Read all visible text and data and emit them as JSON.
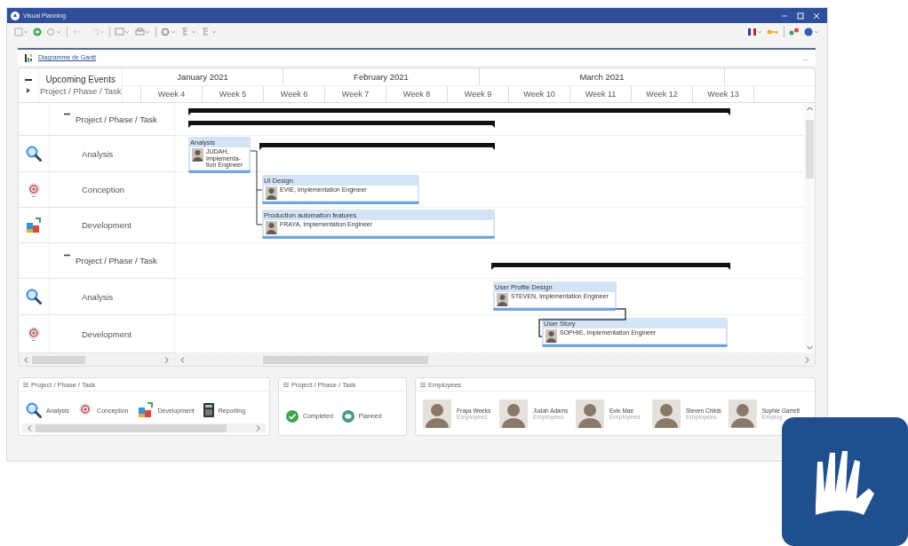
{
  "window": {
    "title": "Visual Planning"
  },
  "tab": {
    "label": "Diagramme de Gantt",
    "menu": "..."
  },
  "gantt": {
    "header_title": "Upcoming Events",
    "header_subtitle": "Project / Phase / Task",
    "months": [
      "January 2021",
      "February 2021",
      "March 2021"
    ],
    "weeks": [
      "Week 4",
      "Week 5",
      "Week 6",
      "Week 7",
      "Week 8",
      "Week 9",
      "Week 10",
      "Week 11",
      "Week 12",
      "Week 13"
    ],
    "rows": [
      {
        "kind": "group",
        "label": "Project / Phase / Task",
        "expanded": true,
        "tasks": []
      },
      {
        "kind": "analysis",
        "label": "Analysis",
        "tasks": [
          {
            "title": "Analysis",
            "assignee": "JUDAH, Implementa-tion Engineer"
          }
        ]
      },
      {
        "kind": "conception",
        "label": "Conception",
        "tasks": [
          {
            "title": "UI Design",
            "assignee": "EVIE, Implementation Engineer"
          }
        ]
      },
      {
        "kind": "development",
        "label": "Development",
        "tasks": [
          {
            "title": "Production automation features",
            "assignee": "FRAYA, Implementation Engineer"
          }
        ]
      },
      {
        "kind": "group",
        "label": "Project / Phase / Task",
        "expanded": true,
        "tasks": []
      },
      {
        "kind": "analysis",
        "label": "Analysis",
        "tasks": [
          {
            "title": "User Profile Design",
            "assignee": "STEVEN, Implementation Engineer"
          }
        ]
      },
      {
        "kind": "conception",
        "label": "Development",
        "tasks": [
          {
            "title": "User Story",
            "assignee": "SOPHIE, Implementation Engineer"
          }
        ]
      }
    ]
  },
  "legend_phases": {
    "title": "Project / Phase / Task",
    "items": [
      {
        "kind": "analysis",
        "label": "Analysis"
      },
      {
        "kind": "conception",
        "label": "Conception"
      },
      {
        "kind": "development",
        "label": "Development"
      },
      {
        "kind": "reporting",
        "label": "Reporting"
      }
    ]
  },
  "legend_status": {
    "title": "Project / Phase / Task",
    "items": [
      {
        "kind": "completed",
        "label": "Completed"
      },
      {
        "kind": "planned",
        "label": "Planned"
      }
    ]
  },
  "employees": {
    "title": "Employees",
    "items": [
      {
        "name": "Fraya Weeks",
        "role": "Employees"
      },
      {
        "name": "Judah Adams",
        "role": "Employees"
      },
      {
        "name": "Evie Mae",
        "role": "Employees"
      },
      {
        "name": "Steven Childs",
        "role": "Employees"
      },
      {
        "name": "Sophie Garrett",
        "role": "Employ"
      }
    ]
  }
}
